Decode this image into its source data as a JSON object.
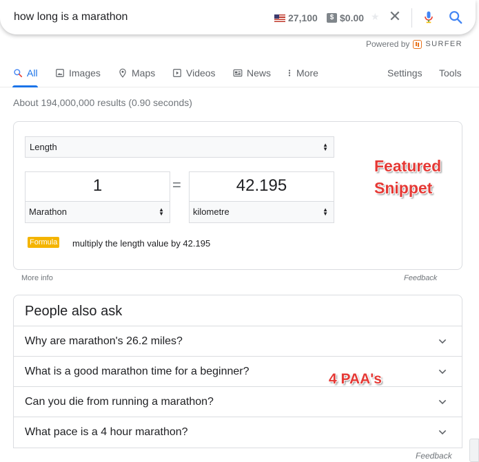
{
  "search": {
    "query": "how long is a marathon",
    "volume": "27,100",
    "cpc": "$0.00",
    "dollar_icon": "$",
    "powered_by": "Powered by",
    "surfer": "SURFER"
  },
  "tabs": [
    {
      "label": "All",
      "icon": "search-icon"
    },
    {
      "label": "Images",
      "icon": "image-icon"
    },
    {
      "label": "Maps",
      "icon": "map-pin-icon"
    },
    {
      "label": "Videos",
      "icon": "play-icon"
    },
    {
      "label": "News",
      "icon": "news-icon"
    },
    {
      "label": "More",
      "icon": "more-vert-icon"
    }
  ],
  "tools": {
    "settings": "Settings",
    "tools": "Tools"
  },
  "stats": "About 194,000,000 results (0.90 seconds)",
  "converter": {
    "category": "Length",
    "from_value": "1",
    "from_unit": "Marathon",
    "equals": "=",
    "to_value": "42.195",
    "to_unit": "kilometre",
    "formula_label": "Formula",
    "formula_text": "multiply the length value by 42.195"
  },
  "annotations": {
    "featured_line1": "Featured",
    "featured_line2": "Snippet",
    "paa": "4 PAA's"
  },
  "more_info": "More info",
  "feedback": "Feedback",
  "paa": {
    "title": "People also ask",
    "questions": [
      "Why are marathon's 26.2 miles?",
      "What is a good marathon time for a beginner?",
      "Can you die from running a marathon?",
      "What pace is a 4 hour marathon?"
    ]
  },
  "colors": {
    "accent": "#1a73e8",
    "annotation": "#e53935",
    "formula_badge": "#f4b400"
  }
}
